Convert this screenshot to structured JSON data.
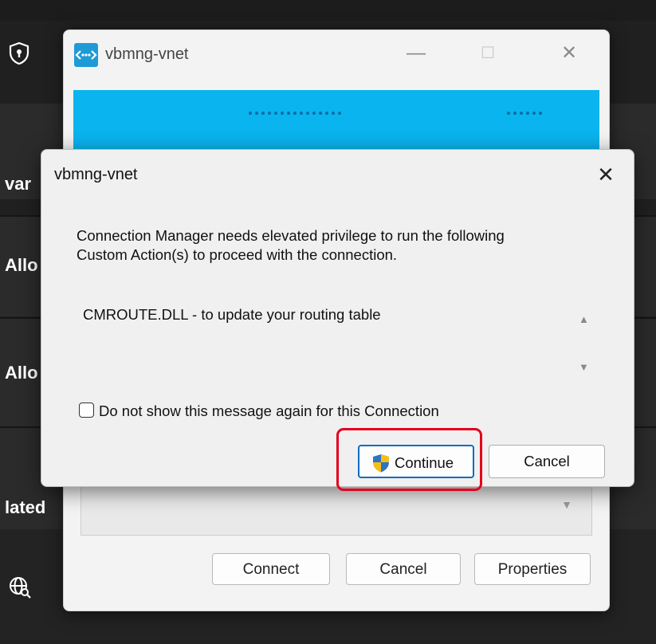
{
  "background": {
    "fragments": [
      "var",
      "Allo",
      "Allo",
      "lated"
    ],
    "icons": [
      "shield-lock-icon",
      "globe-search-icon"
    ]
  },
  "back_window": {
    "title": "vbmng-vnet",
    "app_icon": "network-connection-icon",
    "controls": {
      "minimize": "—",
      "maximize": "☐",
      "close": "✕"
    },
    "select_arrow": "▼",
    "buttons": {
      "connect": "Connect",
      "cancel": "Cancel",
      "properties": "Properties"
    }
  },
  "dialog": {
    "title": "vbmng-vnet",
    "close": "✕",
    "message_line1": "Connection Manager needs elevated privilege to run the following",
    "message_line2": "Custom Action(s) to proceed with the connection.",
    "action_item": "CMROUTE.DLL - to update your routing table",
    "scroll_up": "▲",
    "scroll_down": "▼",
    "checkbox_label": "Do not show this message again for this Connection",
    "checkbox_checked": false,
    "continue_label": "Continue",
    "continue_icon": "uac-shield-icon",
    "cancel_label": "Cancel"
  },
  "colors": {
    "highlight": "#e3001b",
    "banner": "#0ab4ee",
    "focus": "#0e6cbd"
  }
}
